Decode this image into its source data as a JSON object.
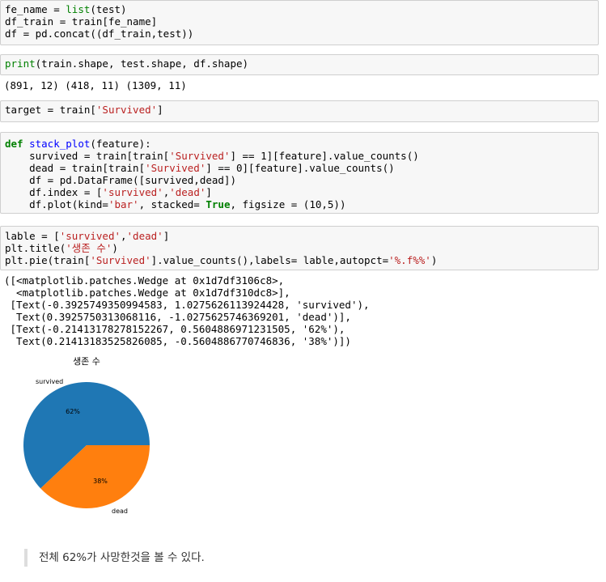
{
  "cells": [
    {
      "lines": [
        "fe_name = list(test)",
        "df_train = train[fe_name]",
        "df = pd.concat((df_train,test))"
      ]
    },
    {
      "lines": [
        "print(train.shape, test.shape, df.shape)"
      ]
    },
    {
      "lines": [
        "target = train['Survived']"
      ]
    },
    {
      "lines": [
        "def stack_plot(feature):",
        "    survived = train[train['Survived'] == 1][feature].value_counts()",
        "    dead = train[train['Survived'] == 0][feature].value_counts()",
        "    df = pd.DataFrame([survived,dead])",
        "    df.index = ['survived','dead']",
        "    df.plot(kind='bar', stacked= True, figsize = (10,5))"
      ]
    },
    {
      "lines": [
        "lable = ['survived','dead']",
        "plt.title('생존 수')",
        "plt.pie(train['Survived'].value_counts(),labels= lable,autopct='%.f%%')"
      ]
    }
  ],
  "outputs": {
    "shape_output": "(891, 12) (418, 11) (1309, 11)",
    "pie_return": [
      "([<matplotlib.patches.Wedge at 0x1d7df3106c8>,",
      "  <matplotlib.patches.Wedge at 0x1d7df310dc8>],",
      " [Text(-0.3925749350994583, 1.0275626113924428, 'survived'),",
      "  Text(0.3925750313068116, -1.0275625746369201, 'dead')],",
      " [Text(-0.21413178278152267, 0.5604886971231505, '62%'),",
      "  Text(0.21413183525826085, -0.5604886770746836, '38%')])"
    ]
  },
  "chart_data": {
    "type": "pie",
    "title": "생존 수",
    "labels": [
      "survived",
      "dead"
    ],
    "values": [
      62,
      38
    ],
    "autopct": [
      "62%",
      "38%"
    ],
    "colors": [
      "#1f77b4",
      "#ff7f0e"
    ]
  },
  "markdown": {
    "text": "전체 62%가 사망한것을 볼 수 있다."
  }
}
